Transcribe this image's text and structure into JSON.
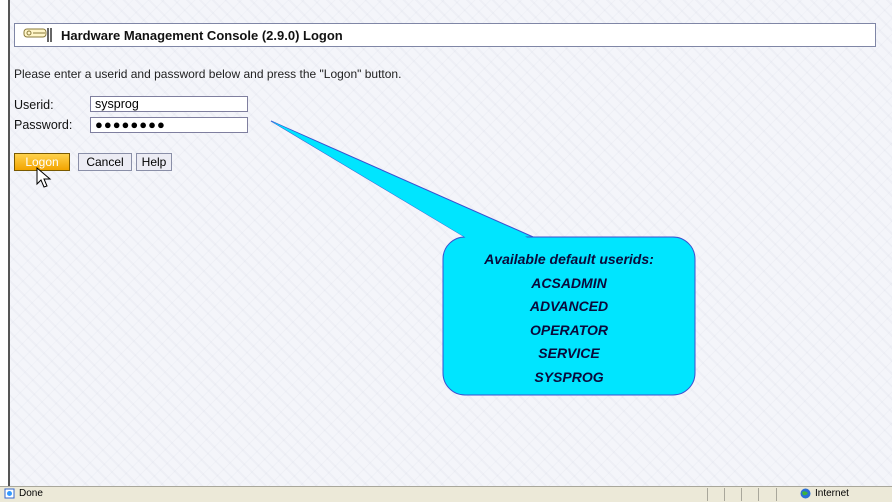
{
  "header": {
    "title": "Hardware Management Console (2.9.0) Logon",
    "icon": "key-icon"
  },
  "instructions": "Please enter a userid and password below and press the \"Logon\" button.",
  "form": {
    "userid_label": "Userid:",
    "userid_value": "sysprog",
    "password_label": "Password:",
    "password_value": "●●●●●●●●"
  },
  "buttons": {
    "logon": "Logon",
    "cancel": "Cancel",
    "help": "Help"
  },
  "callout": {
    "heading": "Available default userids:",
    "userids": [
      "ACSADMIN",
      "ADVANCED",
      "OPERATOR",
      "SERVICE",
      "SYSPROG"
    ],
    "color": "#00e5ff"
  },
  "status_bar": {
    "text": "Done",
    "zone": "Internet"
  },
  "colors": {
    "logon_button": "#f2a400",
    "title_border": "#7f86a6"
  }
}
